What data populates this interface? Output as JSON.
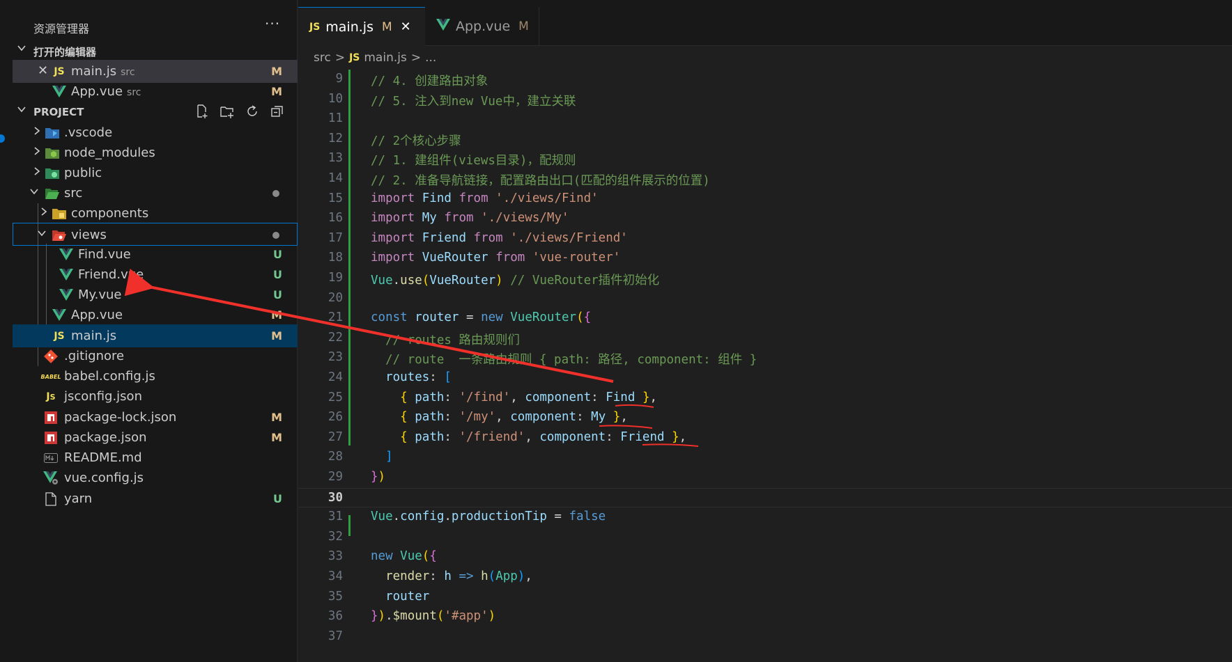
{
  "sidebar": {
    "title": "资源管理器",
    "more": "···",
    "open_editors": {
      "title": "打开的编辑器",
      "items": [
        {
          "icon": "js-icon",
          "name": "main.js",
          "dir": "src",
          "status": "M"
        },
        {
          "icon": "vue-icon",
          "name": "App.vue",
          "dir": "src",
          "status": "M"
        }
      ]
    },
    "project": {
      "title": "PROJECT",
      "tree": [
        {
          "name": ".vscode",
          "status": ""
        },
        {
          "name": "node_modules",
          "status": ""
        },
        {
          "name": "public",
          "status": ""
        },
        {
          "name": "src",
          "status": ""
        },
        {
          "name": "components",
          "status": ""
        },
        {
          "name": "views",
          "status": ""
        },
        {
          "name": "Find.vue",
          "status": "U"
        },
        {
          "name": "Friend.vue",
          "status": "U"
        },
        {
          "name": "My.vue",
          "status": "U"
        },
        {
          "name": "App.vue",
          "status": "M"
        },
        {
          "name": "main.js",
          "status": "M"
        },
        {
          "name": ".gitignore",
          "status": ""
        },
        {
          "name": "babel.config.js",
          "status": ""
        },
        {
          "name": "jsconfig.json",
          "status": ""
        },
        {
          "name": "package-lock.json",
          "status": "M"
        },
        {
          "name": "package.json",
          "status": "M"
        },
        {
          "name": "README.md",
          "status": ""
        },
        {
          "name": "vue.config.js",
          "status": ""
        },
        {
          "name": "yarn",
          "status": "U"
        }
      ]
    }
  },
  "tabs": [
    {
      "icon": "JS",
      "label": "main.js",
      "modified": "M",
      "close": "✕"
    },
    {
      "icon": "V",
      "label": "App.vue",
      "modified": "M"
    }
  ],
  "breadcrumb": {
    "folder": "src",
    "sep": ">",
    "file_icon": "JS",
    "file": "main.js",
    "rest": "..."
  },
  "code": {
    "line_numbers": [
      "9",
      "10",
      "11",
      "12",
      "13",
      "14",
      "15",
      "16",
      "17",
      "18",
      "19",
      "20",
      "21",
      "22",
      "23",
      "24",
      "25",
      "26",
      "27",
      "28",
      "29",
      "30",
      "31",
      "32",
      "33",
      "34",
      "35",
      "36",
      "37"
    ],
    "current_line": "30",
    "l9": "// 4. 创建路由对象",
    "l10": "// 5. 注入到new Vue中，建立关联",
    "l12": "// 2个核心步骤",
    "l13": "// 1. 建组件(views目录)，配规则",
    "l14": "// 2. 准备导航链接，配置路由出口(匹配的组件展示的位置)",
    "l15": {
      "kw": "import",
      "id": "Find",
      "from": "from",
      "str": "'./views/Find'"
    },
    "l16": {
      "kw": "import",
      "id": "My",
      "from": "from",
      "str": "'./views/My'"
    },
    "l17": {
      "kw": "import",
      "id": "Friend",
      "from": "from",
      "str": "'./views/Friend'"
    },
    "l18": {
      "kw": "import",
      "id": "VueRouter",
      "from": "from",
      "str": "'vue-router'"
    },
    "l19": {
      "obj": "Vue",
      "fn": "use",
      "arg": "VueRouter",
      "comment": "// VueRouter插件初始化"
    },
    "l21": {
      "kw": "const",
      "id": "router",
      "op": "=",
      "new": "new",
      "cls": "VueRouter"
    },
    "l22": "// routes 路由规则们",
    "l23": "// route  一条路由规则 { path: 路径, component: 组件 }",
    "l24": {
      "key": "routes",
      "open": "["
    },
    "l25": {
      "path": "'/find'",
      "comp": "Find"
    },
    "l26": {
      "path": "'/my'",
      "comp": "My"
    },
    "l27": {
      "path": "'/friend'",
      "comp": "Friend"
    },
    "l28": "]",
    "l31": {
      "obj": "Vue",
      "p1": "config",
      "p2": "productionTip",
      "val": "false"
    },
    "l33": {
      "new": "new",
      "cls": "Vue"
    },
    "l34": {
      "key": "render",
      "param": "h",
      "arrow": "=>",
      "fn": "h",
      "arg": "App"
    },
    "l35": "router",
    "l36": {
      "fn": "$mount",
      "str": "'#app'"
    },
    "kw_path": "path",
    "kw_component": "component"
  },
  "colors": {
    "accent": "#0078d4",
    "annotation_red": "#f0302a",
    "modified": "#e2c08d",
    "untracked": "#73c991"
  }
}
